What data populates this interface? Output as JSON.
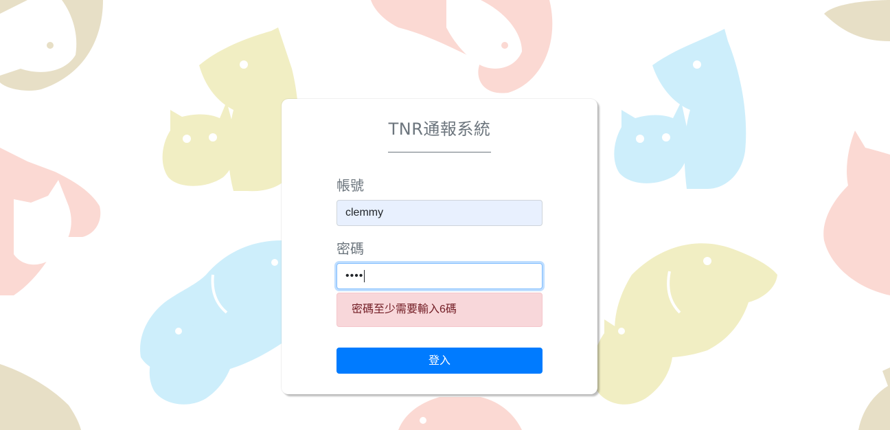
{
  "app": {
    "title": "TNR通報系統"
  },
  "form": {
    "username_label": "帳號",
    "username_value": "clemmy",
    "password_label": "密碼",
    "password_masked": "••••",
    "error_message": "密碼至少需要輸入6碼",
    "submit_label": "登入"
  },
  "colors": {
    "background_tan": "#e7dfc6",
    "background_pink": "#fbd9d3",
    "background_yellow": "#f1eec3",
    "background_blue": "#cdeefb",
    "primary": "#007bff",
    "alert_bg": "#f8d7da",
    "alert_text": "#721c24"
  }
}
